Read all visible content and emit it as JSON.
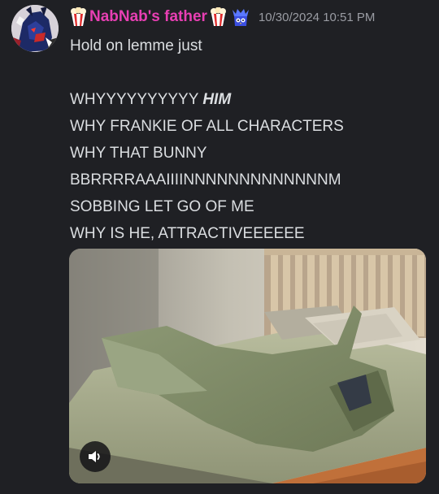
{
  "message": {
    "author": {
      "display_name": "NabNab's father",
      "name_color": "#e83fb3",
      "avatar_icon": "avatar-icon",
      "prefix_emoji": "popcorn-emoji",
      "suffix_emoji": "popcorn-emoji",
      "role_icon": "owl-crown-role-icon"
    },
    "timestamp": "10/30/2024 10:51 PM",
    "lines": [
      {
        "text": "Hold on lemme just"
      },
      {
        "text": ""
      },
      {
        "text": "WHYYYYYYYYYY ",
        "emphasis": "HIM"
      },
      {
        "text": "WHY FRANKIE OF ALL CHARACTERS"
      },
      {
        "text": "WHY THAT BUNNY"
      },
      {
        "text": "BBRRRRAAAIIIINNNNNNNNNNNNNM"
      },
      {
        "text": "SOBBING LET GO OF ME"
      },
      {
        "text": "WHY IS HE, ATTRACTIVEEEEEE"
      }
    ],
    "attachment": {
      "type": "video-gif",
      "volume_icon": "volume-icon"
    }
  }
}
